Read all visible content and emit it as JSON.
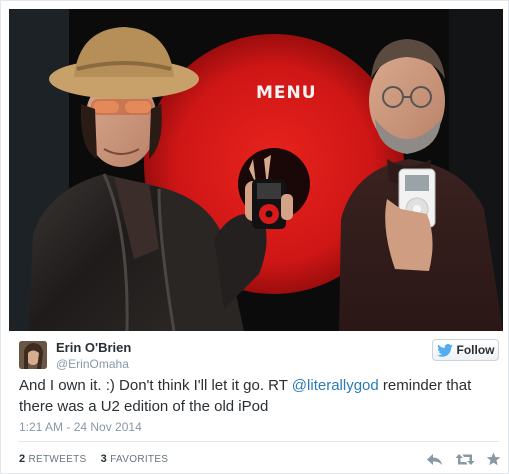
{
  "photo": {
    "stage_text": "MENU",
    "colors": {
      "stage_red": "#d81a1a",
      "backdrop": "#0b0b0c"
    }
  },
  "tweet": {
    "user": {
      "name": "Erin O'Brien",
      "handle": "@ErinOmaha"
    },
    "follow_label": "Follow",
    "text_before": "And I own it. :) Don't think I'll let it go. RT ",
    "mention": "@literallygod",
    "text_after": " reminder that there was a U2 edition of the old iPod",
    "timestamp": "1:21 AM - 24 Nov 2014",
    "stats": {
      "retweets_count": "2",
      "retweets_label": "RETWEETS",
      "favorites_count": "3",
      "favorites_label": "FAVORITES"
    },
    "actions": [
      "reply-icon",
      "retweet-icon",
      "favorite-icon"
    ]
  },
  "colors": {
    "link": "#2b7bb9",
    "muted": "#8899a6",
    "text": "#292f33",
    "twitter_bird": "#55acee"
  }
}
